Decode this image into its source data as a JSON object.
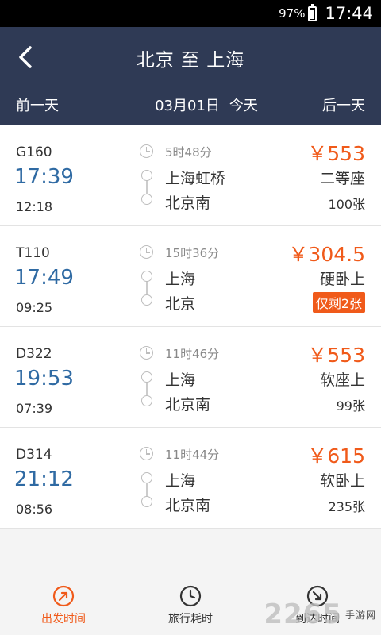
{
  "status_bar": {
    "battery": "97%",
    "time": "17:44"
  },
  "header": {
    "title": "北京 至 上海",
    "prev_day": "前一天",
    "date": "03月01日",
    "today": "今天",
    "next_day": "后一天"
  },
  "trains": [
    {
      "code": "G160",
      "depart": "17:39",
      "arrive": "12:18",
      "duration": "5时48分",
      "from": "上海虹桥",
      "to": "北京南",
      "price": "￥553",
      "seat": "二等座",
      "tickets": "100张",
      "tickets_badge": false
    },
    {
      "code": "T110",
      "depart": "17:49",
      "arrive": "09:25",
      "duration": "15时36分",
      "from": "上海",
      "to": "北京",
      "price": "￥304.5",
      "seat": "硬卧上",
      "tickets": "仅剩2张",
      "tickets_badge": true
    },
    {
      "code": "D322",
      "depart": "19:53",
      "arrive": "07:39",
      "duration": "11时46分",
      "from": "上海",
      "to": "北京南",
      "price": "￥553",
      "seat": "软座上",
      "tickets": "99张",
      "tickets_badge": false
    },
    {
      "code": "D314",
      "depart": "21:12",
      "arrive": "08:56",
      "duration": "11时44分",
      "from": "上海",
      "to": "北京南",
      "price": "￥615",
      "seat": "软卧上",
      "tickets": "235张",
      "tickets_badge": false
    }
  ],
  "bottom_nav": {
    "depart_time": "出发时间",
    "travel_duration": "旅行耗时",
    "arrive_time": "到达时间"
  },
  "watermark": {
    "logo": "2265",
    "site": "手游网"
  },
  "colors": {
    "header_bg": "#2f3a55",
    "accent": "#f05a1a",
    "time_blue": "#2f6aa3"
  }
}
